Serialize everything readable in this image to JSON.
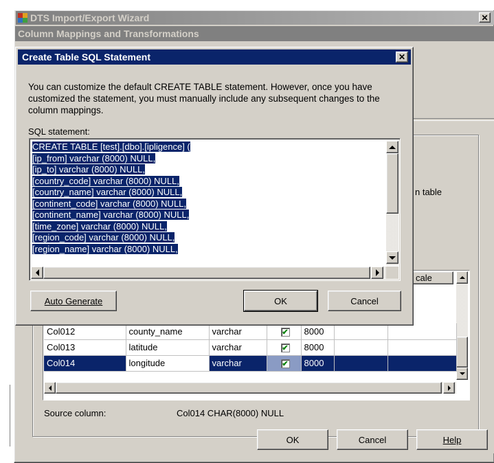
{
  "wizard": {
    "title": "DTS Import/Export Wizard",
    "header": "Column Mappings and Transformations",
    "partial_text": "n table",
    "source_column_label": "Source column:",
    "source_column_value": "Col014 CHAR(8000) NULL",
    "ok_label": "OK",
    "cancel_label": "Cancel",
    "help_label": "Help",
    "grid_header_partial": "cale",
    "rows": [
      {
        "source": "Col012",
        "destination": "county_name",
        "type": "varchar",
        "nullable": true,
        "size": "8000",
        "selected": false
      },
      {
        "source": "Col013",
        "destination": "latitude",
        "type": "varchar",
        "nullable": true,
        "size": "8000",
        "selected": false
      },
      {
        "source": "Col014",
        "destination": "longitude",
        "type": "varchar",
        "nullable": true,
        "size": "8000",
        "selected": true
      }
    ]
  },
  "dialog": {
    "title": "Create Table SQL Statement",
    "description": "You can customize the default CREATE TABLE statement. However, once you have customized the statement, you must manually include any subsequent changes to the column mappings.",
    "sql_label": "SQL statement:",
    "sql_lines": [
      "CREATE TABLE [test].[dbo].[ipligence] (",
      "[ip_from] varchar (8000) NULL,",
      "[ip_to] varchar (8000) NULL,",
      "[country_code] varchar (8000) NULL,",
      "[country_name] varchar (8000) NULL,",
      "[continent_code] varchar (8000) NULL,",
      "[continent_name] varchar (8000) NULL,",
      "[time_zone] varchar (8000) NULL,",
      "[region_code] varchar (8000) NULL,",
      "[region_name] varchar (8000) NULL,"
    ],
    "auto_generate_label": "Auto Generate",
    "ok_label": "OK",
    "cancel_label": "Cancel"
  },
  "colors": {
    "titlebar": "#0a246a",
    "titlebar_inactive": "#808080",
    "face": "#d4d0c8",
    "selection": "#0a246a"
  }
}
